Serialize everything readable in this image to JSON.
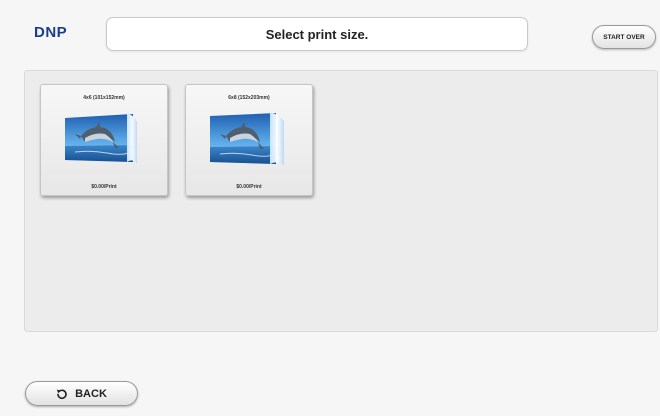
{
  "header": {
    "logo": "DNP",
    "title": "Select print size.",
    "start_over_label": "START OVER"
  },
  "sizes": [
    {
      "size_label": "4x6 (101x152mm)",
      "price_label": "$0.00/Print",
      "photo": "dolphin-photo"
    },
    {
      "size_label": "6x8 (152x203mm)",
      "price_label": "$0.00/Print",
      "photo": "dolphin-photo"
    }
  ],
  "footer": {
    "back_label": "BACK",
    "back_icon": "undo-arrow-icon"
  },
  "colors": {
    "logo": "#1a3d8f",
    "sky": "#3a7fc8",
    "sea": "#1d5fa8"
  }
}
